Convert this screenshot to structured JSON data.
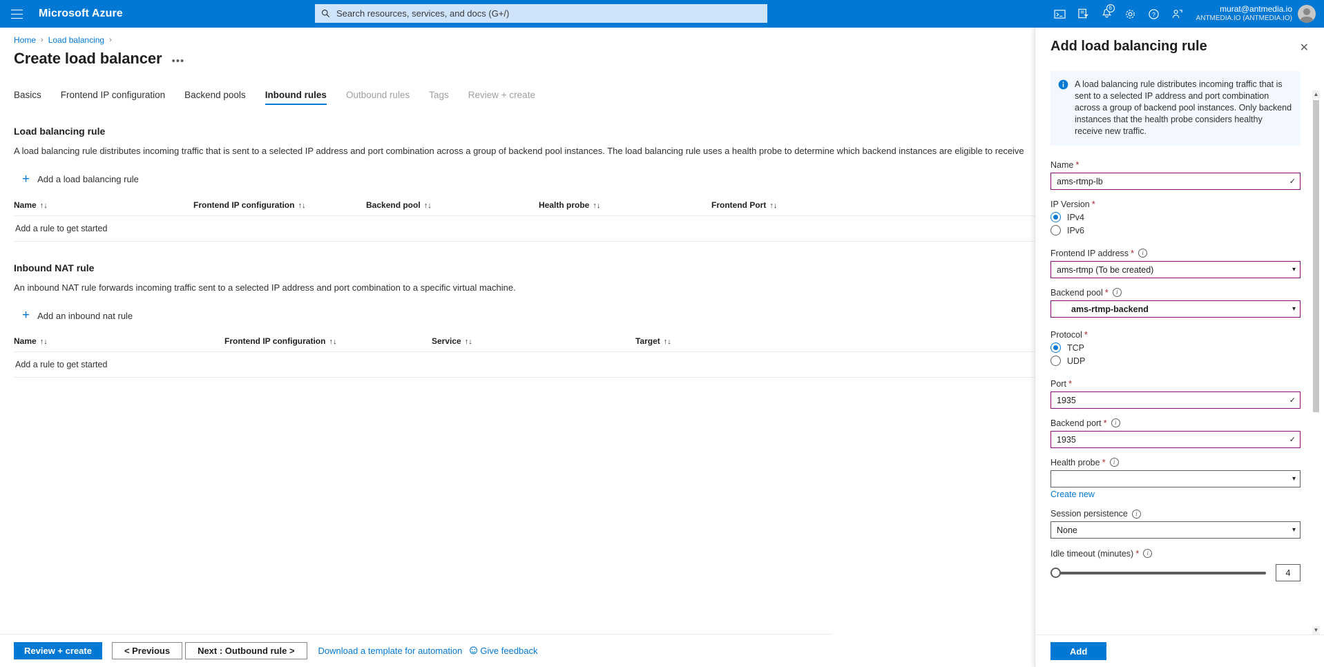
{
  "topbar": {
    "menu_icon": "hamburger-icon",
    "brand": "Microsoft Azure",
    "search_placeholder": "Search resources, services, and docs (G+/)",
    "search_value": "",
    "icons": [
      {
        "name": "cloud-shell-icon",
        "glyph": ">_"
      },
      {
        "name": "directories-filter-icon",
        "glyph": "▤"
      },
      {
        "name": "notifications-icon",
        "glyph": "🔔",
        "badge": "6"
      },
      {
        "name": "settings-gear-icon",
        "glyph": "⚙"
      },
      {
        "name": "help-icon",
        "glyph": "?"
      },
      {
        "name": "feedback-person-icon",
        "glyph": "☺"
      }
    ],
    "account_email": "murat@antmedia.io",
    "account_tenant": "ANTMEDIA.IO (ANTMEDIA.IO)"
  },
  "breadcrumb": {
    "items": [
      "Home",
      "Load balancing"
    ],
    "separator": "›"
  },
  "page": {
    "title": "Create load balancer",
    "more_label": "•••"
  },
  "tabs": [
    {
      "label": "Basics",
      "state": "enabled"
    },
    {
      "label": "Frontend IP configuration",
      "state": "enabled"
    },
    {
      "label": "Backend pools",
      "state": "enabled"
    },
    {
      "label": "Inbound rules",
      "state": "active"
    },
    {
      "label": "Outbound rules",
      "state": "disabled"
    },
    {
      "label": "Tags",
      "state": "disabled"
    },
    {
      "label": "Review + create",
      "state": "disabled"
    }
  ],
  "sections": {
    "lb_rule": {
      "title": "Load balancing rule",
      "description": "A load balancing rule distributes incoming traffic that is sent to a selected IP address and port combination across a group of backend pool instances. The load balancing rule uses a health probe to determine which backend instances are eligible to receive",
      "add_label": "Add a load balancing rule",
      "add_icon": "plus-icon",
      "columns": [
        "Name",
        "Frontend IP configuration",
        "Backend pool",
        "Health probe",
        "Frontend Port"
      ],
      "sort_icon": "↑↓",
      "empty_text": "Add a rule to get started"
    },
    "nat_rule": {
      "title": "Inbound NAT rule",
      "description": "An inbound NAT rule forwards incoming traffic sent to a selected IP address and port combination to a specific virtual machine.",
      "add_label": "Add an inbound nat rule",
      "add_icon": "plus-icon",
      "columns": [
        "Name",
        "Frontend IP configuration",
        "Service",
        "Target"
      ],
      "sort_icon": "↑↓",
      "empty_text": "Add a rule to get started"
    }
  },
  "actionbar": {
    "review_create": "Review + create",
    "previous": "< Previous",
    "next": "Next : Outbound rule >",
    "download_template": "Download a template for automation",
    "give_feedback": "Give feedback",
    "feedback_icon": "smiley-feedback-icon"
  },
  "blade": {
    "title": "Add load balancing rule",
    "close_icon": "close-icon",
    "info": {
      "icon": "info-icon",
      "text": "A load balancing rule distributes incoming traffic that is sent to a selected IP address and port combination across a group of backend pool instances. Only backend instances that the health probe considers healthy receive new traffic."
    },
    "fields": {
      "name": {
        "label": "Name",
        "required": true,
        "value": "ams-rtmp-lb",
        "validation_icon": "checkmark-icon"
      },
      "ip_version": {
        "label": "IP Version",
        "required": true,
        "selected": "IPv4",
        "options": [
          "IPv4",
          "IPv6"
        ]
      },
      "frontend_ip": {
        "label": "Frontend IP address",
        "required": true,
        "info": true,
        "value": "ams-rtmp (To be created)",
        "chevron_icon": "chevron-down-icon"
      },
      "backend_pool": {
        "label": "Backend pool",
        "required": true,
        "info": true,
        "value": "ams-rtmp-backend",
        "chevron_icon": "chevron-down-icon"
      },
      "protocol": {
        "label": "Protocol",
        "required": true,
        "selected": "TCP",
        "options": [
          "TCP",
          "UDP"
        ]
      },
      "port": {
        "label": "Port",
        "required": true,
        "value": "1935",
        "validation_icon": "checkmark-icon"
      },
      "backend_port": {
        "label": "Backend port",
        "required": true,
        "info": true,
        "value": "1935",
        "validation_icon": "checkmark-icon"
      },
      "health_probe": {
        "label": "Health probe",
        "required": true,
        "info": true,
        "value": "",
        "chevron_icon": "chevron-down-icon",
        "create_new": "Create new"
      },
      "session_persistence": {
        "label": "Session persistence",
        "required": false,
        "info": true,
        "value": "None",
        "chevron_icon": "chevron-down-icon"
      },
      "idle_timeout": {
        "label": "Idle timeout (minutes)",
        "required": true,
        "info": true,
        "value": "4",
        "slider_percent": 0
      }
    },
    "submit_label": "Add",
    "scrollbar": {
      "up_icon": "▲",
      "down_icon": "▼"
    }
  },
  "colors": {
    "azure_blue": "#0078d4",
    "required_red": "#a4262c",
    "input_border_modified": "#8a0a7d",
    "info_bg": "#f2f8fd"
  }
}
